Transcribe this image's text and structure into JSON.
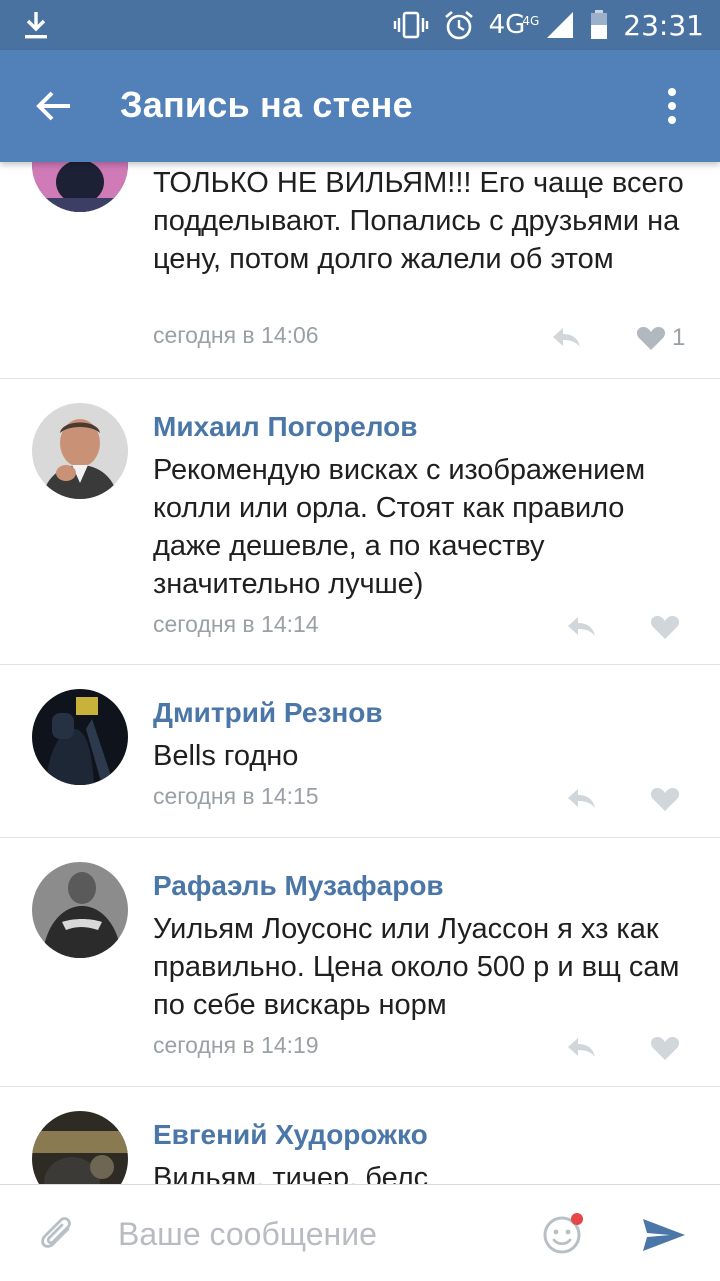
{
  "status_bar": {
    "time": "23:31",
    "network": "4G",
    "network_sub": "4G"
  },
  "header": {
    "title": "Запись на стене"
  },
  "comments": [
    {
      "author": "",
      "text": "ТОЛЬКО НЕ ВИЛЬЯМ!!! Его чаще всего подделывают. Попались с друзьями на цену, потом долго жалели об этом",
      "time": "сегодня в 14:06",
      "likes": "1"
    },
    {
      "author": "Михаил Погорелов",
      "text": "Рекомендую висках с изображением колли или орла. Стоят как правило даже дешевле, а по качеству значительно лучше)",
      "time": "сегодня в 14:14",
      "likes": ""
    },
    {
      "author": "Дмитрий Резнов",
      "text": "Bells годно",
      "time": "сегодня в 14:15",
      "likes": ""
    },
    {
      "author": "Рафаэль Музафаров",
      "text": "Уильям Лоусонс или Луассон я хз как правильно. Цена около 500 р и вщ сам по себе вискарь норм",
      "time": "сегодня в 14:19",
      "likes": ""
    },
    {
      "author": "Евгений Худорожко",
      "text": "Вильям, тичер, белс",
      "time": "",
      "likes": ""
    }
  ],
  "composer": {
    "placeholder": "Ваше сообщение"
  },
  "colors": {
    "statusbar": "#4a72a1",
    "header": "#5181b8",
    "author": "#4a76a8",
    "meta": "#9aa0a6",
    "send": "#4a76a8"
  }
}
